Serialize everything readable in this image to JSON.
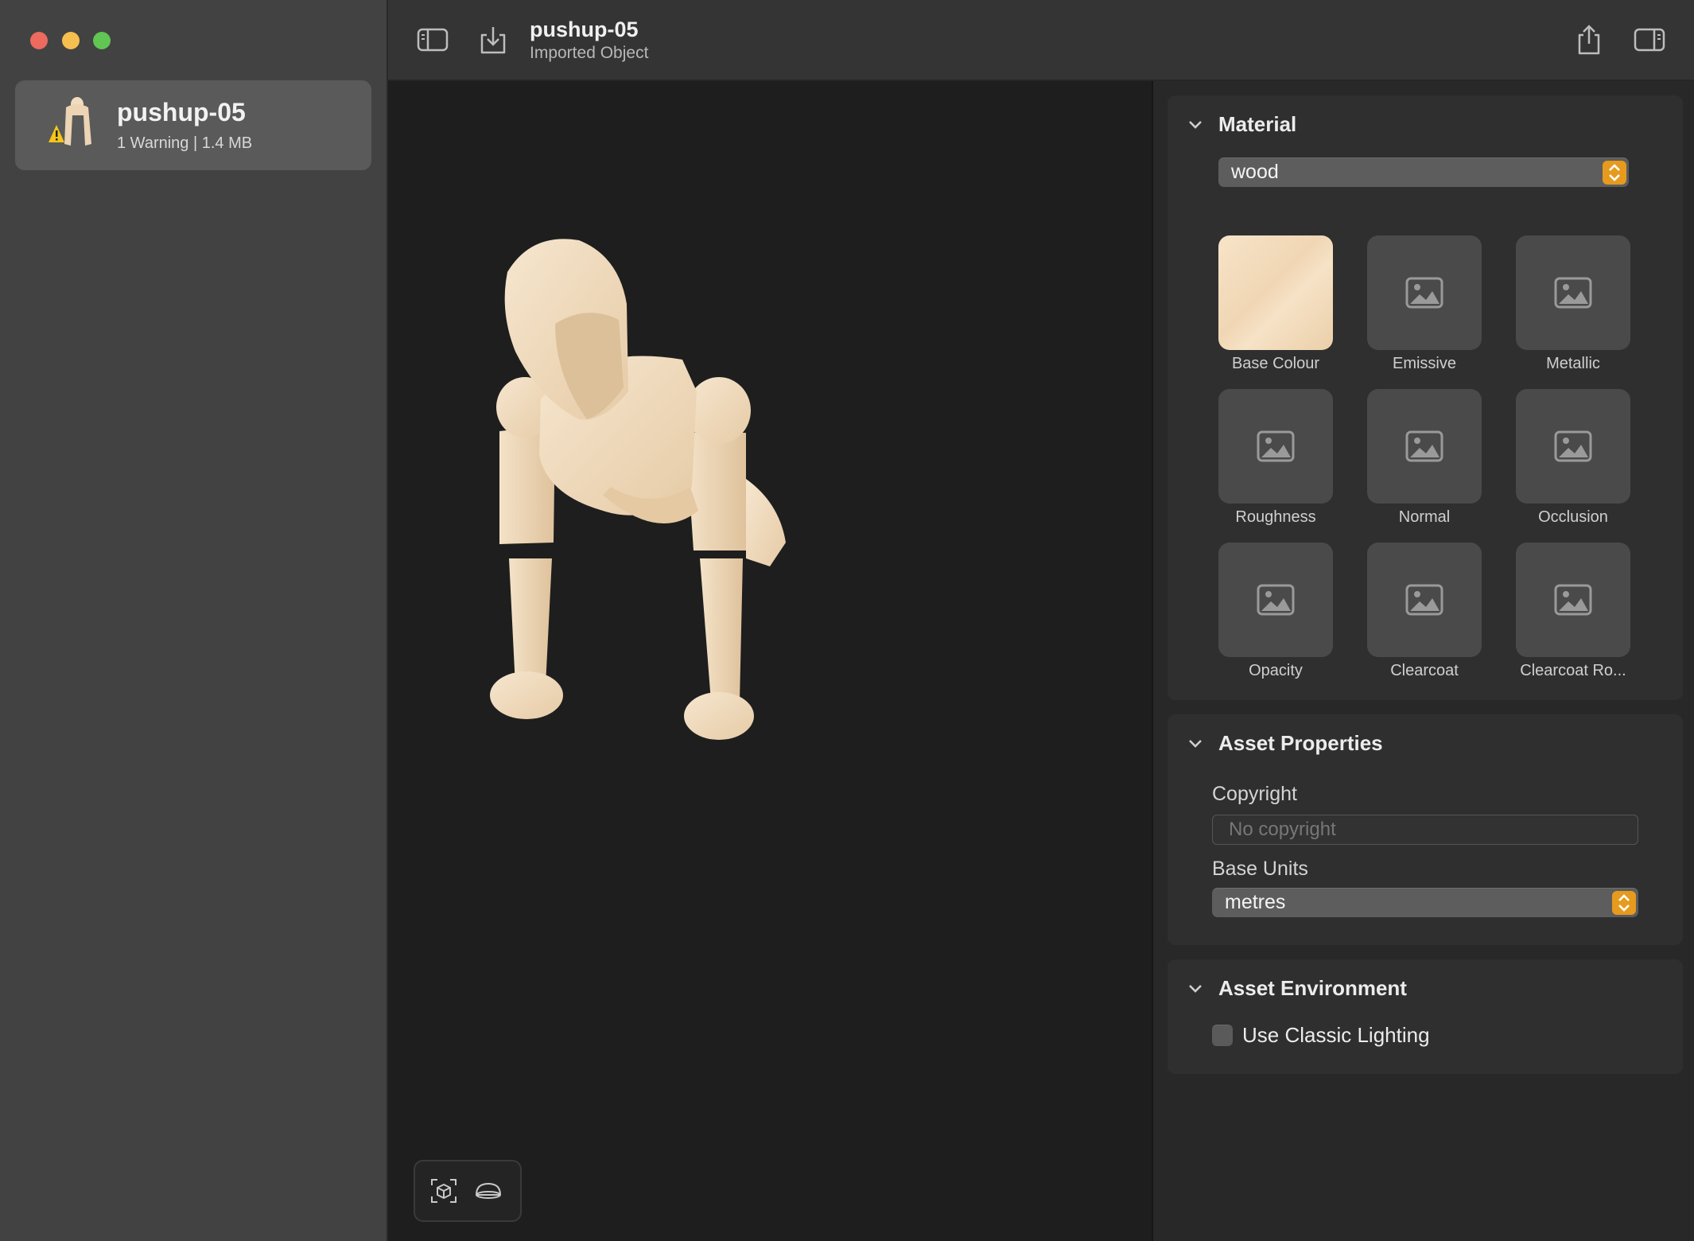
{
  "window": {
    "title": "pushup-05",
    "subtitle": "Imported Object"
  },
  "sidebar": {
    "file": {
      "name": "pushup-05",
      "meta": "1 Warning | 1.4 MB"
    }
  },
  "inspector": {
    "material": {
      "title": "Material",
      "selected": "wood",
      "textures": [
        {
          "label": "Base Colour",
          "filled": true
        },
        {
          "label": "Emissive"
        },
        {
          "label": "Metallic"
        },
        {
          "label": "Roughness"
        },
        {
          "label": "Normal"
        },
        {
          "label": "Occlusion"
        },
        {
          "label": "Opacity"
        },
        {
          "label": "Clearcoat"
        },
        {
          "label": "Clearcoat Ro..."
        }
      ]
    },
    "asset_properties": {
      "title": "Asset Properties",
      "copyright_label": "Copyright",
      "copyright_placeholder": "No copyright",
      "base_units_label": "Base Units",
      "base_units_value": "metres"
    },
    "asset_environment": {
      "title": "Asset Environment",
      "classic_lighting_label": "Use Classic Lighting",
      "classic_lighting_checked": false
    }
  },
  "colors": {
    "accent": "#e69a1e",
    "close": "#ed6a5e",
    "minimize": "#f5bf4f",
    "zoom": "#61c554",
    "wood": "#f1dcc0"
  }
}
